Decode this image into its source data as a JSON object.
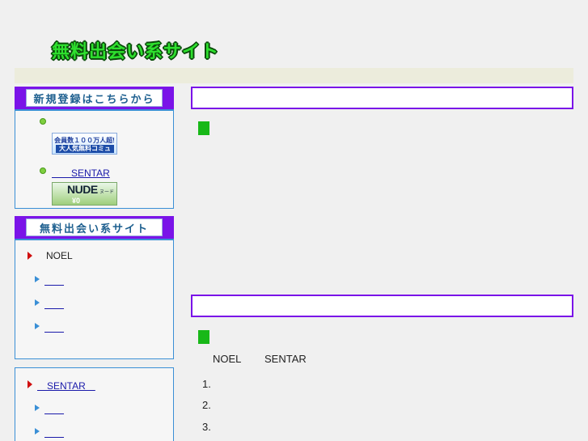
{
  "header": {
    "logo_text": "無料出会い系サイト"
  },
  "sidebar": {
    "register_box": {
      "title": "新規登録はこちらから",
      "items": [
        {
          "label": "",
          "banner_lines": [
            "会員数１００万人超!",
            "大人気無料コミュ"
          ]
        },
        {
          "label": "　　SENTAR",
          "banner_title": "NUDE",
          "banner_sub": "ヌード",
          "banner_price": "¥0"
        }
      ]
    },
    "sites_box": {
      "title": "無料出会い系サイト",
      "main_item": "NOEL",
      "sub_items": [
        "　　",
        "　　",
        "　　"
      ]
    },
    "sentar_box": {
      "main_item": "　SENTAR　",
      "sub_items": [
        "　　",
        "　　"
      ]
    }
  },
  "main": {
    "section1": {
      "title": ""
    },
    "section2": {
      "title": "",
      "names": [
        "NOEL",
        "SENTAR"
      ],
      "list_numbers": [
        "1.",
        "2.",
        "3."
      ]
    }
  },
  "colors": {
    "accent_purple": "#7a13e8",
    "box_border_blue": "#3a8fd6",
    "logo_green": "#2ee02e",
    "marker_green": "#18b818",
    "arrow_red": "#d01010"
  },
  "icons": {
    "bullet_dot": "green-dot-icon",
    "red_arrow": "red-arrow-icon",
    "blue_arrow": "blue-arrow-icon"
  }
}
